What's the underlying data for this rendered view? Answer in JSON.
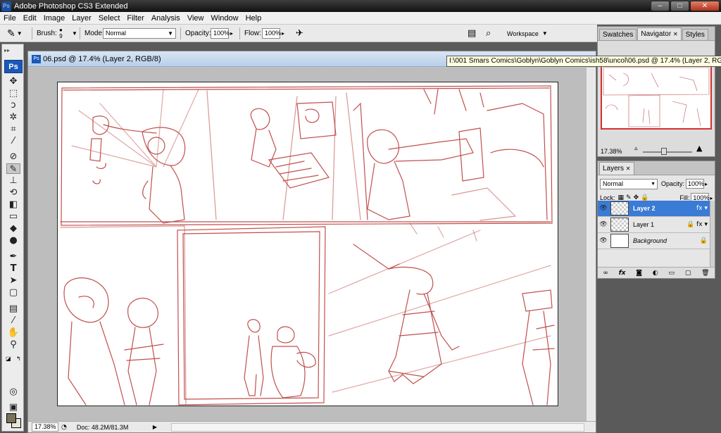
{
  "app": {
    "title": "Adobe Photoshop CS3 Extended",
    "badge": "Ps"
  },
  "window_controls": {
    "minimize": "–",
    "maximize": "□",
    "close": "✕"
  },
  "menu": [
    "File",
    "Edit",
    "Image",
    "Layer",
    "Select",
    "Filter",
    "Analysis",
    "View",
    "Window",
    "Help"
  ],
  "options": {
    "brush_label": "Brush:",
    "brush_size": "9",
    "mode_label": "Mode:",
    "mode_value": "Normal",
    "opacity_label": "Opacity:",
    "opacity_value": "100%",
    "flow_label": "Flow:",
    "flow_value": "100%",
    "workspace_label": "Workspace"
  },
  "tools_panel": {
    "logo": "Ps"
  },
  "tool_icons": {
    "move": "✥",
    "marquee": "⬚",
    "lasso": "ↄ",
    "magic_wand": "✲",
    "crop": "⌗",
    "eyedropper": "⁄",
    "healing": "⊘",
    "brush": "✎",
    "stamp": "⊥",
    "history": "⟲",
    "eraser": "◧",
    "gradient": "▭",
    "blur": "◆",
    "dodge": "●",
    "pen": "✒",
    "type": "T",
    "path_select": "➤",
    "shape": "▢",
    "notes": "▤",
    "eyedropper2": "⁄",
    "hand": "✋",
    "zoom": "⚲",
    "quickmask": "◎",
    "screen": "▣"
  },
  "document": {
    "title": "06.psd @ 17.4% (Layer 2, RGB/8)",
    "path_tooltip": "I:\\001 Smars Comics\\Goblyn\\Goblyn Comics\\ish58\\uncol\\06.psd @ 17.4% (Layer 2, RGB/8)",
    "zoom": "17.38%",
    "doc_info": "Doc: 48.2M/81.3M"
  },
  "navigator": {
    "tabs": [
      "Swatches",
      "Navigator",
      "Styles"
    ],
    "active_tab": "Navigator",
    "zoom": "17.38%",
    "slider_level": 0.42
  },
  "layers_panel": {
    "tab": "Layers",
    "blend_mode": "Normal",
    "opacity_label": "Opacity:",
    "opacity_value": "100%",
    "lock_label": "Lock:",
    "fill_label": "Fill:",
    "fill_value": "100%",
    "layers": [
      {
        "name": "Layer 2",
        "selected": true,
        "badges": "fx ▾"
      },
      {
        "name": "Layer 1",
        "selected": false,
        "badges": "🔒 fx ▾"
      },
      {
        "name": "Background",
        "selected": false,
        "badges": "🔒"
      }
    ]
  },
  "colors": {
    "sketch": "#c0504d",
    "selection": "#3a7bd5",
    "foreground": "#7a7358",
    "background": "#e8e4d8"
  }
}
